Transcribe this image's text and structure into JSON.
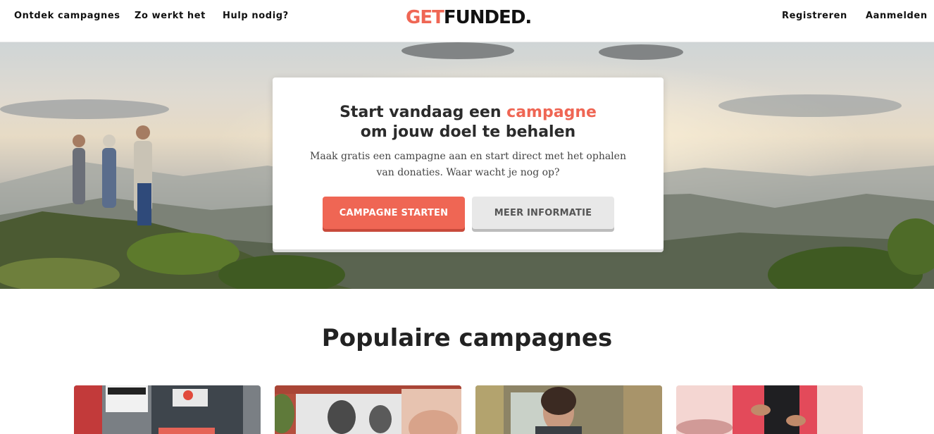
{
  "nav": {
    "left_links": [
      "Ontdek campagnes",
      "Zo werkt het",
      "Hulp nodig?"
    ],
    "logo_part1": "GET",
    "logo_part2": "FUNDED.",
    "right_links": [
      "Registreren",
      "Aanmelden"
    ]
  },
  "hero": {
    "title_line1_prefix": "Start vandaag een ",
    "title_accent": "campagne",
    "title_line2": "om jouw doel te behalen",
    "description": "Maak gratis een campagne aan en start direct met het ophalen van donaties. Waar wacht je nog op?",
    "primary_button": "CAMPAGNE STARTEN",
    "secondary_button": "MEER INFORMATIE"
  },
  "popular": {
    "title": "Populaire campagnes",
    "cards": [
      {
        "image": "storefront-photo"
      },
      {
        "image": "family-portrait-photo"
      },
      {
        "image": "woman-portrait-photo"
      },
      {
        "image": "hands-photo"
      }
    ]
  },
  "colors": {
    "accent": "#ef6654",
    "accent_dark": "#c84a3b",
    "secondary_button": "#e8e8e8"
  }
}
